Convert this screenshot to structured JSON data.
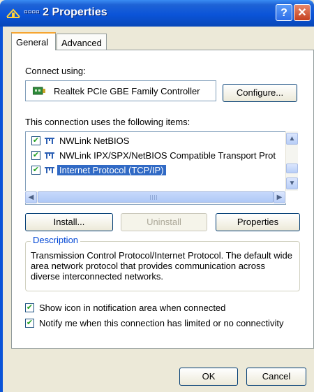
{
  "window": {
    "title": "▫▫▫▫ 2 Properties",
    "help_glyph": "?",
    "close_glyph": "✕",
    "icon": "network-connection-icon"
  },
  "tabs": [
    {
      "label": "General",
      "selected": true
    },
    {
      "label": "Advanced",
      "selected": false
    }
  ],
  "connect_using": {
    "label": "Connect using:",
    "adapter_name": "Realtek PCIe GBE Family Controller",
    "adapter_icon": "network-card-icon",
    "configure_label": "Configure..."
  },
  "items_section": {
    "label": "This connection uses the following items:",
    "items": [
      {
        "label": "NWLink NetBIOS",
        "checked": true,
        "selected": false
      },
      {
        "label": "NWLink IPX/SPX/NetBIOS Compatible Transport Prot",
        "checked": true,
        "selected": false
      },
      {
        "label": "Internet Protocol (TCP/IP)",
        "checked": true,
        "selected": true
      }
    ],
    "item_icon": "protocol-icon"
  },
  "buttons": {
    "install": "Install...",
    "uninstall": "Uninstall",
    "properties": "Properties",
    "ok": "OK",
    "cancel": "Cancel"
  },
  "description": {
    "title": "Description",
    "text": "Transmission Control Protocol/Internet Protocol. The default wide area network protocol that provides communication across diverse interconnected networks."
  },
  "options": [
    {
      "label": "Show icon in notification area when connected",
      "checked": true
    },
    {
      "label": "Notify me when this connection has limited or no connectivity",
      "checked": true
    }
  ],
  "colors": {
    "titlebar": "#0b54d8",
    "selection": "#316ac5",
    "tab_accent": "#f6a531",
    "group_title": "#0046d5"
  }
}
